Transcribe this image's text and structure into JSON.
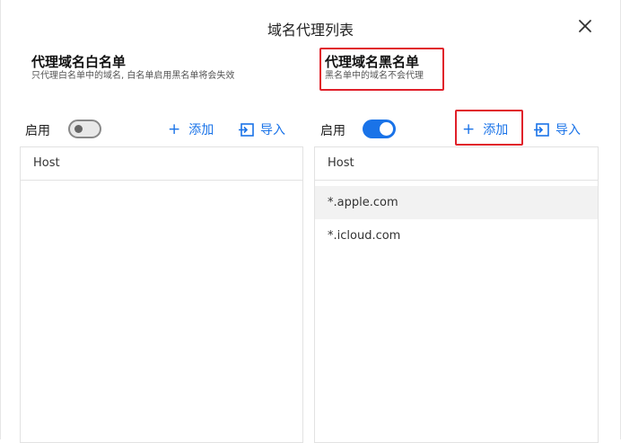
{
  "dialog": {
    "title": "域名代理列表"
  },
  "whitelist": {
    "title": "代理域名白名单",
    "subtitle": "只代理白名单中的域名, 白名单启用黑名单将会失效",
    "enable_label": "启用",
    "enabled": false,
    "add_label": "添加",
    "import_label": "导入",
    "column_header": "Host",
    "rows": []
  },
  "blacklist": {
    "title": "代理域名黑名单",
    "subtitle": "黑名单中的域名不会代理",
    "enable_label": "启用",
    "enabled": true,
    "add_label": "添加",
    "import_label": "导入",
    "column_header": "Host",
    "rows": [
      "*.apple.com",
      "*.icloud.com"
    ]
  },
  "colors": {
    "accent": "#1a73e8",
    "highlight_box": "#e0202a",
    "selected_row": "#f2f2f2"
  },
  "icons": {
    "close": "close-icon",
    "add": "plus-icon",
    "import": "import-icon"
  }
}
